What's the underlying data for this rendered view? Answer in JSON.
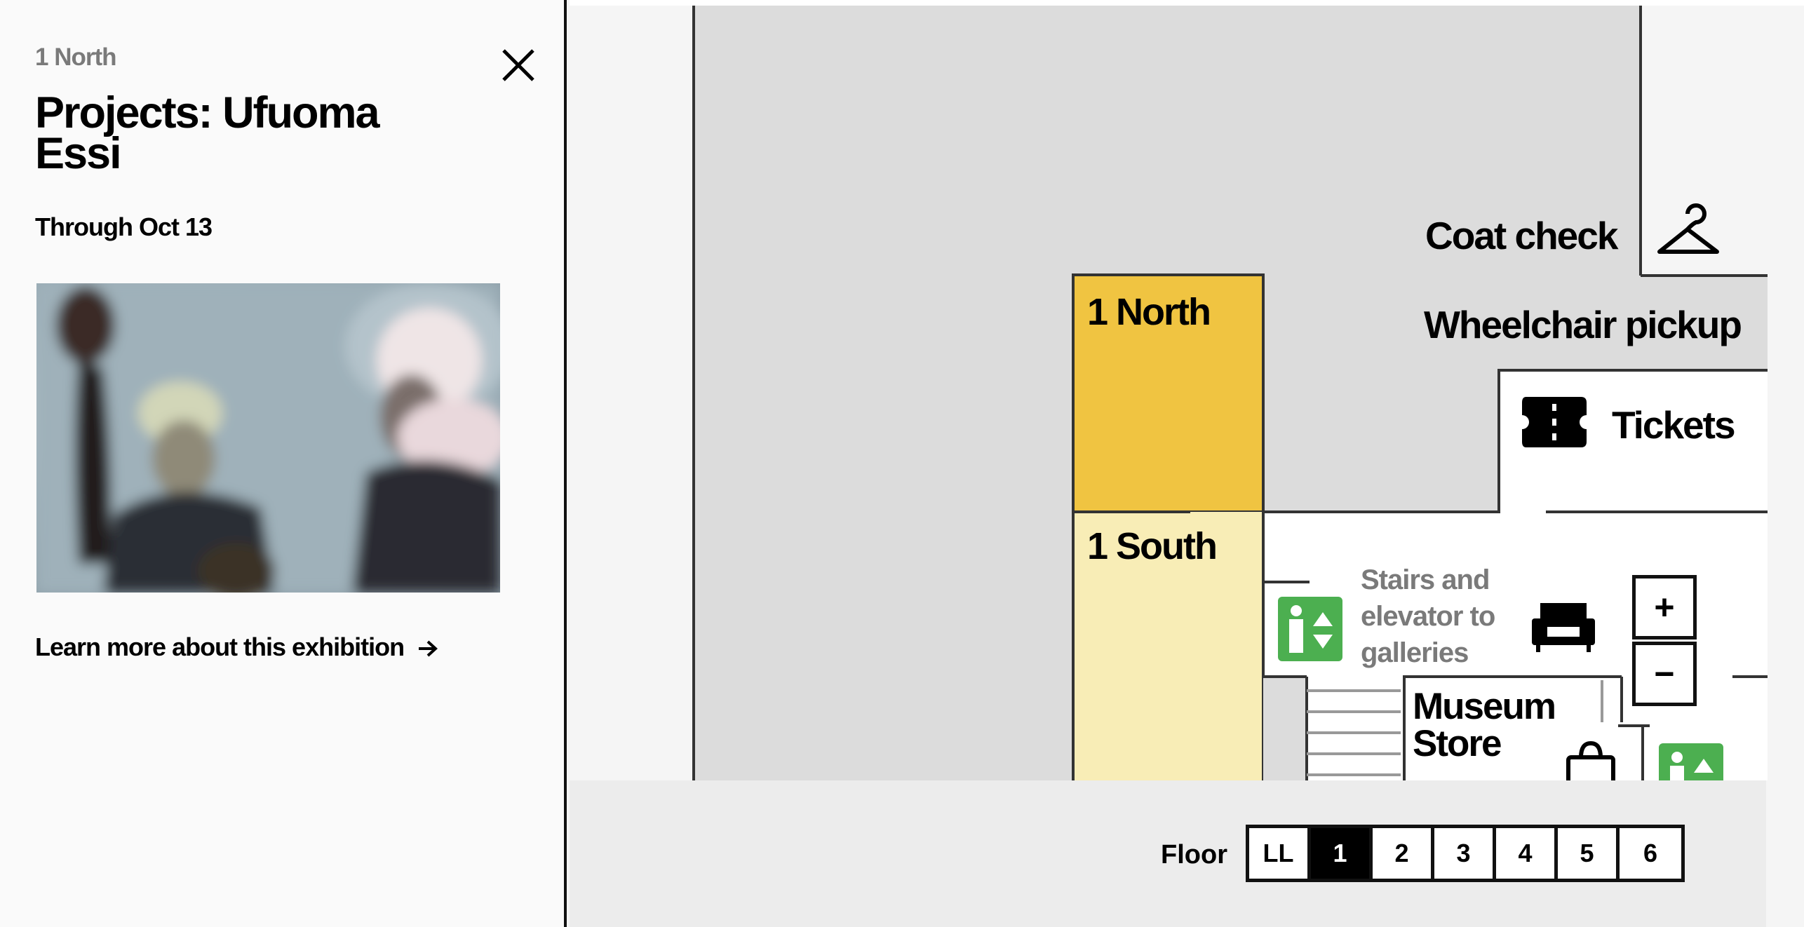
{
  "panel": {
    "gallery": "1 North",
    "title": "Projects: Ufuoma Essi",
    "dates": "Through Oct 13",
    "image": {
      "description_icon": "exhibition-image"
    },
    "learn_more": "Learn more about this exhibition",
    "close_icon": "close-icon",
    "arrow_icon": "arrow-right-icon"
  },
  "map": {
    "labels": {
      "coat_check": "Coat check",
      "wheelchair_pickup": "Wheelchair pickup",
      "tickets": "Tickets",
      "north": "1 North",
      "south": "1 South",
      "stairs_line1": "Stairs and",
      "stairs_line2": "elevator to",
      "stairs_line3": "galleries",
      "store_line1": "Museum",
      "store_line2": "Store"
    },
    "colors": {
      "north_gallery": "#f0c441",
      "south_gallery": "#f8edb6",
      "elevator_icon": "#4caf50",
      "gallery_gray": "#dcdcdc"
    },
    "icons": [
      "hanger-icon",
      "ticket-icon",
      "elevator-icon",
      "sofa-icon",
      "shopping-bag-icon"
    ]
  },
  "zoom": {
    "in_label": "+",
    "out_label": "−"
  },
  "floor_selector": {
    "label": "Floor",
    "floors": [
      "LL",
      "1",
      "2",
      "3",
      "4",
      "5",
      "6"
    ],
    "selected": "1"
  }
}
